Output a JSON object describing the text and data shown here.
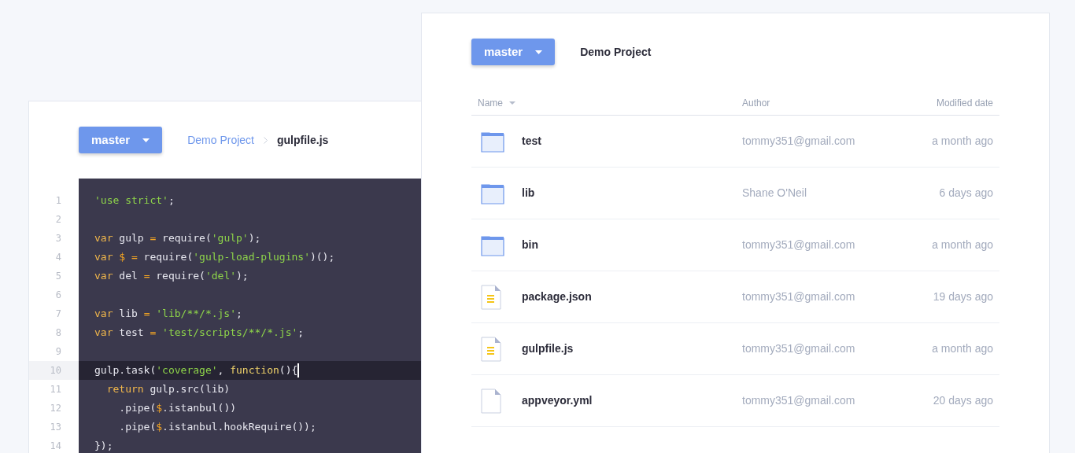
{
  "editor": {
    "branch": "master",
    "breadcrumb": [
      "Demo Project",
      "gulpfile.js"
    ],
    "lines": [
      {
        "number": "1",
        "selected": false,
        "tokens": [
          {
            "kind": "string",
            "text": "'use strict'"
          },
          {
            "kind": "plain",
            "text": ";"
          }
        ]
      },
      {
        "number": "2",
        "selected": false
      },
      {
        "number": "3",
        "selected": false,
        "tokens": [
          {
            "kind": "keyword",
            "text": "var"
          },
          {
            "kind": "plain",
            "text": " gulp "
          },
          {
            "kind": "operator",
            "text": "="
          },
          {
            "kind": "plain",
            "text": " require("
          },
          {
            "kind": "string",
            "text": "'gulp'"
          },
          {
            "kind": "plain",
            "text": ");"
          }
        ]
      },
      {
        "number": "4",
        "selected": false,
        "tokens": [
          {
            "kind": "keyword",
            "text": "var "
          },
          {
            "kind": "operator",
            "text": "$ ="
          },
          {
            "kind": "plain",
            "text": " require("
          },
          {
            "kind": "string",
            "text": "'gulp-load-plugins'"
          },
          {
            "kind": "plain",
            "text": ")();"
          }
        ]
      },
      {
        "number": "5",
        "selected": false,
        "tokens": [
          {
            "kind": "keyword",
            "text": "var"
          },
          {
            "kind": "plain",
            "text": " del "
          },
          {
            "kind": "operator",
            "text": "="
          },
          {
            "kind": "plain",
            "text": " require("
          },
          {
            "kind": "string",
            "text": "'del'"
          },
          {
            "kind": "plain",
            "text": ");"
          }
        ]
      },
      {
        "number": "6",
        "selected": false
      },
      {
        "number": "7",
        "selected": false,
        "tokens": [
          {
            "kind": "keyword",
            "text": "var"
          },
          {
            "kind": "plain",
            "text": " lib "
          },
          {
            "kind": "operator",
            "text": "="
          },
          {
            "kind": "string",
            "text": " 'lib/**/*.js'"
          },
          {
            "kind": "plain",
            "text": ";"
          }
        ]
      },
      {
        "number": "8",
        "selected": false,
        "tokens": [
          {
            "kind": "keyword",
            "text": "var"
          },
          {
            "kind": "plain",
            "text": " test "
          },
          {
            "kind": "operator",
            "text": "="
          },
          {
            "kind": "string",
            "text": " 'test/scripts/**/*.js'"
          },
          {
            "kind": "plain",
            "text": ";"
          }
        ]
      },
      {
        "number": "9",
        "selected": false
      },
      {
        "number": "10",
        "selected": true,
        "tokens": [
          {
            "kind": "plain",
            "text": "gulp.task("
          },
          {
            "kind": "string",
            "text": "'coverage'"
          },
          {
            "kind": "plain",
            "text": ", "
          },
          {
            "kind": "function",
            "text": "function"
          },
          {
            "kind": "plain",
            "text": "(){"
          }
        ]
      },
      {
        "number": "11",
        "selected": false,
        "tokens": [
          {
            "kind": "keyword",
            "text": "  return"
          },
          {
            "kind": "plain",
            "text": " gulp.src(lib)"
          }
        ]
      },
      {
        "number": "12",
        "selected": false,
        "tokens": [
          {
            "kind": "plain",
            "text": "    .pipe("
          },
          {
            "kind": "operator",
            "text": "$"
          },
          {
            "kind": "plain",
            "text": ".istanbul())"
          }
        ]
      },
      {
        "number": "13",
        "selected": false,
        "tokens": [
          {
            "kind": "plain",
            "text": "    .pipe("
          },
          {
            "kind": "operator",
            "text": "$"
          },
          {
            "kind": "plain",
            "text": ".istanbul.hookRequire());"
          }
        ]
      },
      {
        "number": "14",
        "selected": false,
        "tokens": [
          {
            "kind": "plain",
            "text": "});"
          }
        ]
      }
    ]
  },
  "browser": {
    "branch": "master",
    "title": "Demo Project",
    "columns": [
      "Name",
      "Author",
      "Modified date"
    ],
    "rows": [
      {
        "kind": "folder",
        "name": "test",
        "author": "tommy351@gmail.com",
        "modified": "a month ago"
      },
      {
        "kind": "folder",
        "name": "lib",
        "author": "Shane O'Neil",
        "modified": "6 days ago"
      },
      {
        "kind": "folder",
        "name": "bin",
        "author": "tommy351@gmail.com",
        "modified": "a month ago"
      },
      {
        "kind": "file",
        "color": "#f5c518",
        "name": "package.json",
        "author": "tommy351@gmail.com",
        "modified": "19 days ago"
      },
      {
        "kind": "file",
        "color": "#f5c518",
        "name": "gulpfile.js",
        "author": "tommy351@gmail.com",
        "modified": "a month ago"
      },
      {
        "kind": "blank",
        "name": "appveyor.yml",
        "author": "tommy351@gmail.com",
        "modified": "20 days ago"
      }
    ]
  }
}
